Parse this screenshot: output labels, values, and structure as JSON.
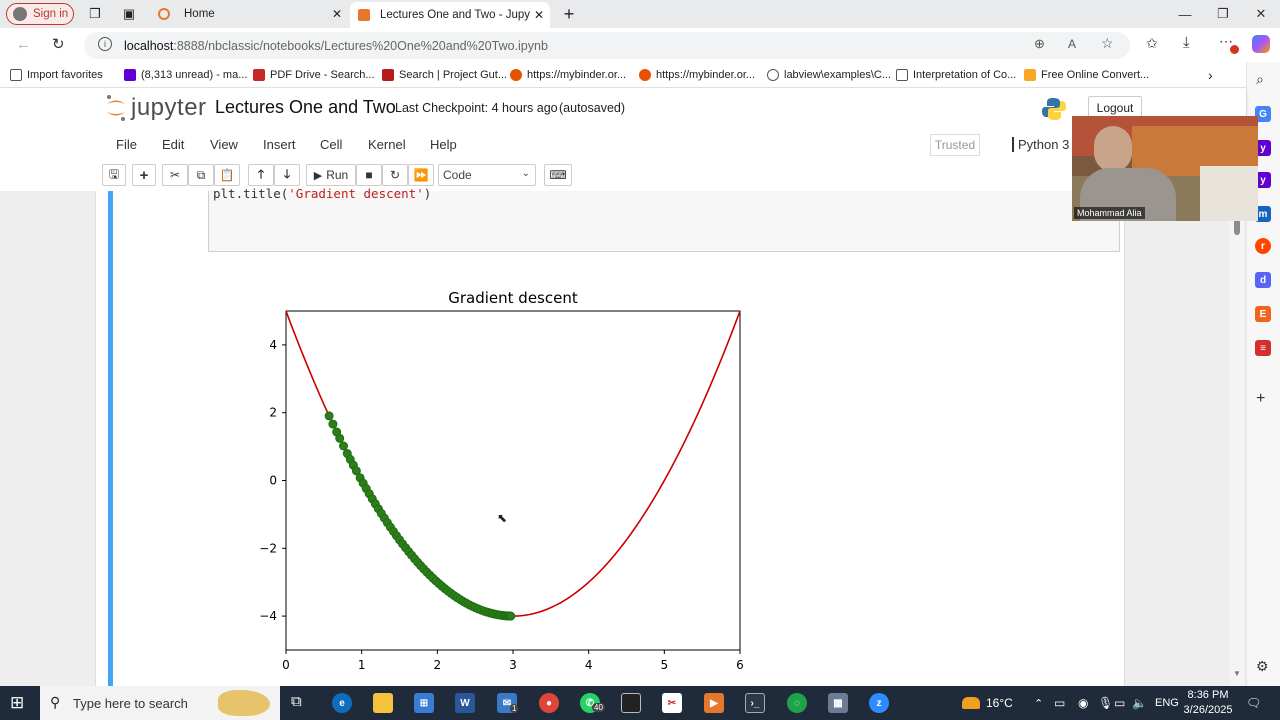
{
  "browser": {
    "signin_label": "Sign in",
    "tabs": [
      {
        "label": "Home"
      },
      {
        "label": "Lectures One and Two - Jupyter N"
      }
    ],
    "url_host": "localhost",
    "url_path": ":8888/nbclassic/notebooks/Lectures%20One%20and%20Two.ipynb",
    "bookmarks": [
      {
        "label": "Import favorites"
      },
      {
        "label": "(8,313 unread) - ma..."
      },
      {
        "label": "PDF Drive - Search..."
      },
      {
        "label": "Search | Project Gut..."
      },
      {
        "label": "https://mybinder.or..."
      },
      {
        "label": "https://mybinder.or..."
      },
      {
        "label": "labview\\examples\\C..."
      },
      {
        "label": "Interpretation of Co..."
      },
      {
        "label": "Free Online Convert..."
      }
    ]
  },
  "jupyter": {
    "logo_text": "jupyter",
    "notebook_title": "Lectures One and Two",
    "checkpoint": "Last Checkpoint: 4 hours ago",
    "autosave": "(autosaved)",
    "logout_label": "Logout",
    "menu": [
      "File",
      "Edit",
      "View",
      "Insert",
      "Cell",
      "Kernel",
      "Help"
    ],
    "trusted_label": "Trusted",
    "kernel_label": "Python 3 (",
    "run_label": "Run",
    "cell_type": "Code",
    "code_line_prefix": "plt.title(",
    "code_line_string": "'Gradient descent'",
    "code_line_suffix": ")"
  },
  "webcam": {
    "participant_name": "Mohammad Alia"
  },
  "taskbar": {
    "search_placeholder": "Type here to search",
    "weather": "16°C",
    "language": "ENG",
    "time": "8:36 PM",
    "date": "3/26/2025",
    "whatsapp_badge": "40",
    "mail_badge": "1"
  },
  "chart_data": {
    "type": "line",
    "title": "Gradient descent",
    "xlabel": "",
    "ylabel": "",
    "xlim": [
      0,
      6
    ],
    "ylim": [
      -5,
      5
    ],
    "xticks": [
      0,
      1,
      2,
      3,
      4,
      5,
      6
    ],
    "yticks": [
      -4,
      -2,
      0,
      2,
      4
    ],
    "curve": {
      "function": "(x-3)^2 - 4",
      "x_min": 0,
      "x_max": 6,
      "color": "#cc0000"
    },
    "points_color": "#2e7d1a",
    "points_edge_color": "#1b6e10",
    "points": {
      "x": [
        0.57,
        0.62,
        0.67,
        0.71,
        0.76,
        0.81,
        0.85,
        0.89,
        0.93,
        0.98,
        1.02,
        1.06,
        1.1,
        1.14,
        1.18,
        1.22,
        1.26,
        1.3,
        1.34,
        1.38,
        1.42,
        1.46,
        1.5,
        1.54,
        1.58,
        1.62,
        1.66,
        1.7,
        1.74,
        1.78,
        1.82,
        1.86,
        1.9,
        1.94,
        1.98,
        2.02,
        2.06,
        2.1,
        2.14,
        2.18,
        2.22,
        2.26,
        2.3,
        2.34,
        2.38,
        2.42,
        2.46,
        2.5,
        2.54,
        2.58,
        2.62,
        2.66,
        2.7,
        2.73,
        2.76,
        2.79,
        2.82,
        2.85,
        2.88,
        2.9,
        2.92,
        2.94,
        2.96,
        2.97
      ]
    }
  }
}
